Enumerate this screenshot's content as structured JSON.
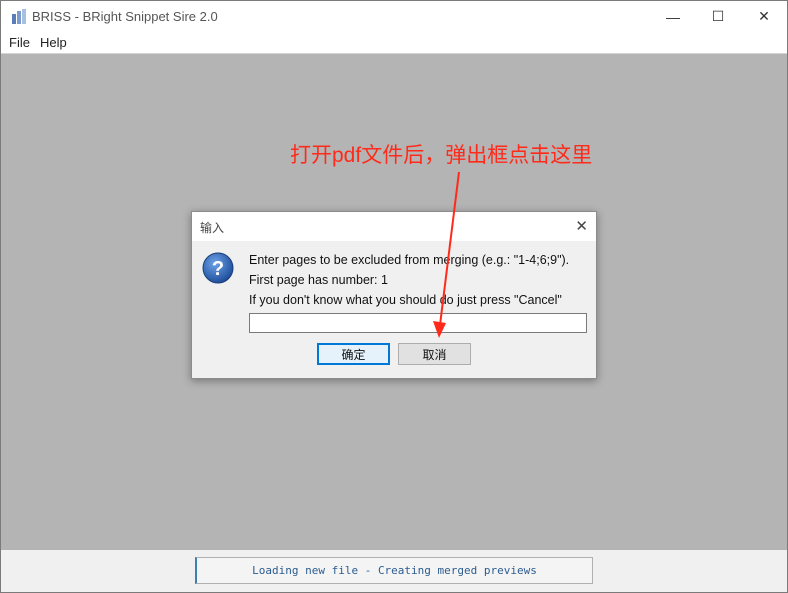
{
  "window": {
    "title": "BRISS - BRight Snippet Sire 2.0",
    "controls": {
      "minimize": "—",
      "maximize": "☐",
      "close": "✕"
    }
  },
  "menu": [
    {
      "label": "File"
    },
    {
      "label": "Help"
    }
  ],
  "dialog": {
    "title": "输入",
    "close": "✕",
    "lines": [
      "Enter pages to be excluded from merging (e.g.: \"1-4;6;9\").",
      "First page has number: 1",
      "If you don't know what you should do just press \"Cancel\""
    ],
    "input_value": "",
    "ok_label": "确定",
    "cancel_label": "取消"
  },
  "annotation": {
    "text": "打开pdf文件后，弹出框点击这里",
    "color": "#ff2a1a"
  },
  "status": {
    "text": "Loading new file - Creating merged previews"
  },
  "colors": {
    "workspace": "#b4b4b4",
    "accent": "#0078d7"
  },
  "icons": [
    "app-icon",
    "question-icon",
    "close-icon",
    "minimize-icon",
    "maximize-icon",
    "arrow-annotation"
  ]
}
